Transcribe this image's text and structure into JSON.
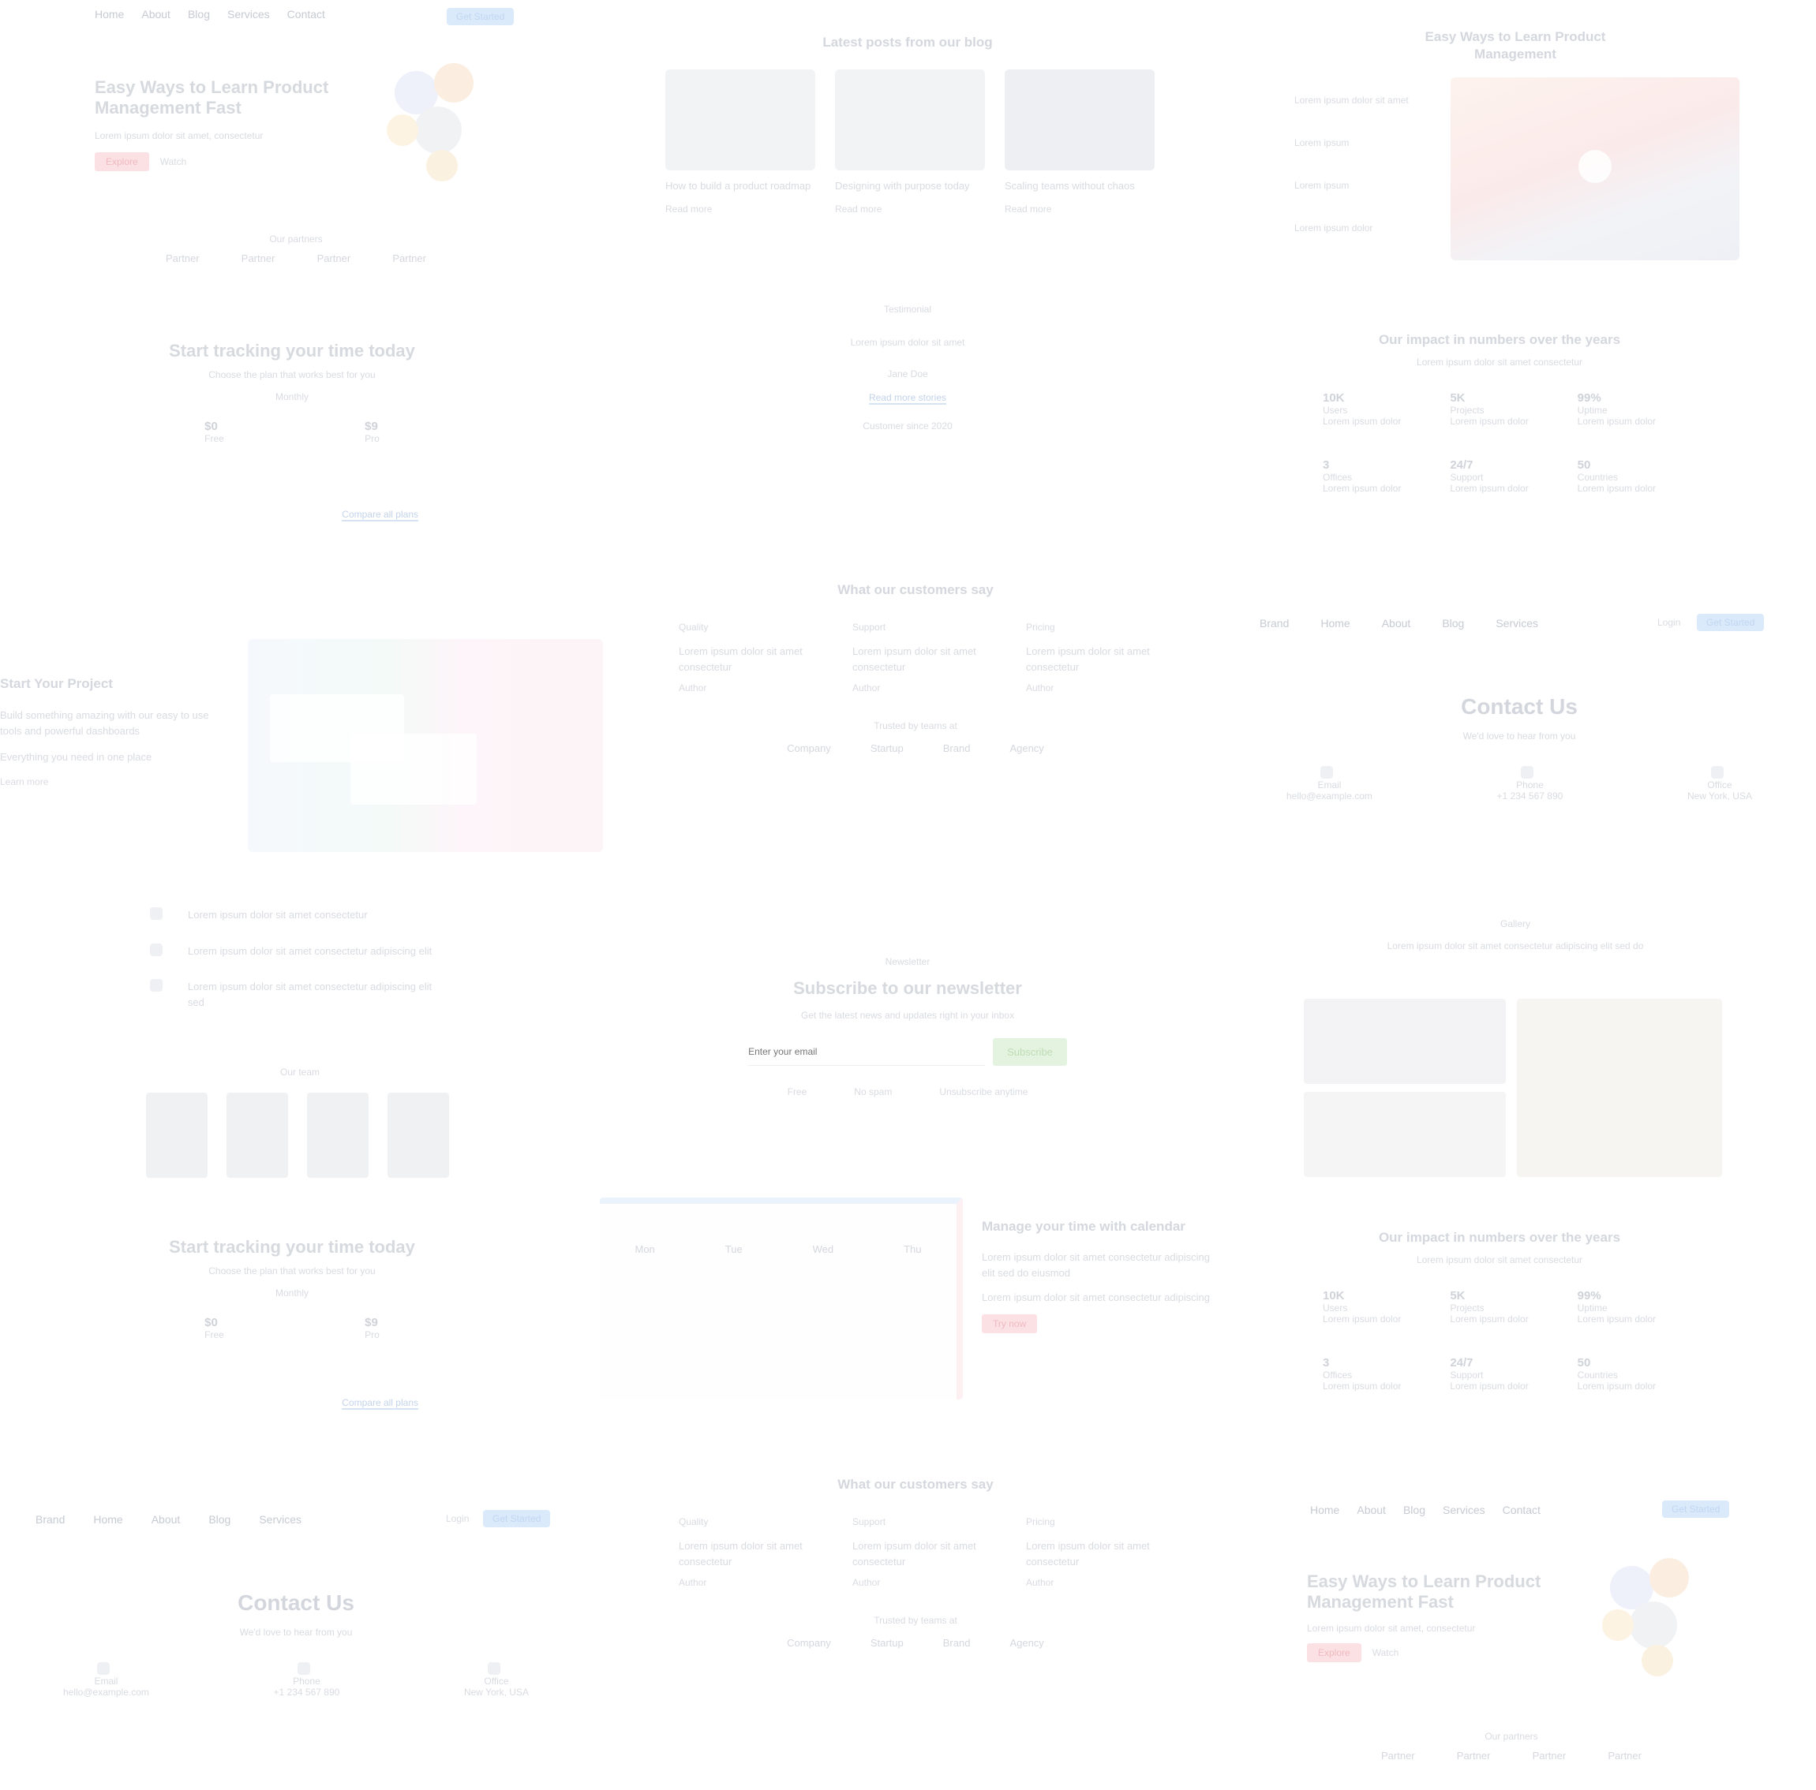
{
  "nav_a": {
    "items": [
      "Home",
      "About",
      "Blog",
      "Services",
      "Contact"
    ],
    "cta": "Get Started"
  },
  "hero_a": {
    "title": "Easy Ways to Learn Product Management Fast",
    "subtitle": "Lorem ipsum dolor sit amet, consectetur",
    "primary": "Explore",
    "secondary": "Watch",
    "partners_label": "Our partners",
    "partners": [
      "Partner",
      "Partner",
      "Partner",
      "Partner"
    ]
  },
  "pricing_a": {
    "title": "Start tracking your time today",
    "subtitle": "Choose the plan that works best for you",
    "toggle": "Monthly",
    "plans": [
      {
        "price": "$0",
        "name": "Free"
      },
      {
        "price": "$9",
        "name": "Pro"
      }
    ],
    "cta": "Compare all plans"
  },
  "project_a": {
    "title": "Start Your Project",
    "desc": "Build something amazing with our easy to use tools and powerful dashboards",
    "sub": "Everything you need in one place",
    "link": "Learn more"
  },
  "checklist": {
    "items": [
      "Lorem ipsum dolor sit amet consectetur",
      "Lorem ipsum dolor sit amet consectetur adipiscing elit",
      "Lorem ipsum dolor sit amet consectetur adipiscing elit sed"
    ],
    "team_label": "Our team"
  },
  "pricing_b": {
    "title": "Start tracking your time today",
    "subtitle": "Choose the plan that works best for you",
    "toggle": "Monthly",
    "plans": [
      {
        "price": "$0",
        "name": "Free"
      },
      {
        "price": "$9",
        "name": "Pro"
      }
    ],
    "cta": "Compare all plans"
  },
  "nav_b": {
    "logo": "Brand",
    "items": [
      "Home",
      "About",
      "Blog",
      "Services"
    ],
    "login": "Login",
    "cta": "Get Started"
  },
  "contact_a": {
    "title": "Contact Us",
    "subtitle": "We'd love to hear from you",
    "items": [
      {
        "label": "Email",
        "value": "hello@example.com"
      },
      {
        "label": "Phone",
        "value": "+1 234 567 890"
      },
      {
        "label": "Office",
        "value": "New York, USA"
      }
    ]
  },
  "articles": {
    "title": "Latest posts from our blog",
    "posts": [
      {
        "title": "How to build a product roadmap",
        "meta": "Read more"
      },
      {
        "title": "Designing with purpose today",
        "meta": "Read more"
      },
      {
        "title": "Scaling teams without chaos",
        "meta": "Read more"
      }
    ]
  },
  "testimonial": {
    "label": "Testimonial",
    "quote": "Lorem ipsum dolor sit amet",
    "author": "Jane Doe",
    "cta": "Read more stories",
    "note": "Customer since 2020"
  },
  "faq_a": {
    "title": "What our customers say",
    "cols": [
      {
        "h": "Quality",
        "t": "Lorem ipsum dolor sit amet consectetur",
        "m": "Author"
      },
      {
        "h": "Support",
        "t": "Lorem ipsum dolor sit amet consectetur",
        "m": "Author"
      },
      {
        "h": "Pricing",
        "t": "Lorem ipsum dolor sit amet consectetur",
        "m": "Author"
      }
    ],
    "logos_label": "Trusted by teams at",
    "logos": [
      "Company",
      "Startup",
      "Brand",
      "Agency"
    ]
  },
  "newsletter": {
    "eyebrow": "Newsletter",
    "title": "Subscribe to our newsletter",
    "subtitle": "Get the latest news and updates right in your inbox",
    "placeholder": "Enter your email",
    "cta": "Subscribe",
    "perks": [
      "Free",
      "No spam",
      "Unsubscribe anytime"
    ]
  },
  "calendar_feature": {
    "title": "Manage your time with calendar",
    "desc": "Lorem ipsum dolor sit amet consectetur adipiscing elit sed do eiusmod",
    "desc2": "Lorem ipsum dolor sit amet consectetur adipiscing",
    "cta": "Try now",
    "days": [
      "Mon",
      "Tue",
      "Wed",
      "Thu"
    ]
  },
  "faq_b": {
    "title": "What our customers say",
    "cols": [
      {
        "h": "Quality",
        "t": "Lorem ipsum dolor sit amet consectetur",
        "m": "Author"
      },
      {
        "h": "Support",
        "t": "Lorem ipsum dolor sit amet consectetur",
        "m": "Author"
      },
      {
        "h": "Pricing",
        "t": "Lorem ipsum dolor sit amet consectetur",
        "m": "Author"
      }
    ],
    "logos_label": "Trusted by teams at",
    "logos": [
      "Company",
      "Startup",
      "Brand",
      "Agency"
    ]
  },
  "nav_c": {
    "logo": "Brand",
    "items": [
      "Home",
      "About",
      "Blog",
      "Services"
    ],
    "login": "Login",
    "cta": "Get Started"
  },
  "contact_b": {
    "title": "Contact Us",
    "subtitle": "We'd love to hear from you",
    "items": [
      {
        "label": "Email",
        "value": "hello@example.com"
      },
      {
        "label": "Phone",
        "value": "+1 234 567 890"
      },
      {
        "label": "Office",
        "value": "New York, USA"
      }
    ]
  },
  "video": {
    "title": "Easy Ways to Learn Product Management",
    "items": [
      "Lorem ipsum dolor sit amet",
      "Lorem ipsum",
      "Lorem ipsum",
      "Lorem ipsum dolor"
    ]
  },
  "stats_a": {
    "title": "Our impact in numbers over the years",
    "subtitle": "Lorem ipsum dolor sit amet consectetur",
    "stats": [
      {
        "n": "10K",
        "l": "Users",
        "s": "Lorem ipsum dolor"
      },
      {
        "n": "5K",
        "l": "Projects",
        "s": "Lorem ipsum dolor"
      },
      {
        "n": "99%",
        "l": "Uptime",
        "s": "Lorem ipsum dolor"
      },
      {
        "n": "3",
        "l": "Offices",
        "s": "Lorem ipsum dolor"
      },
      {
        "n": "24/7",
        "l": "Support",
        "s": "Lorem ipsum dolor"
      },
      {
        "n": "50",
        "l": "Countries",
        "s": "Lorem ipsum dolor"
      }
    ]
  },
  "gallery": {
    "title": "Gallery",
    "subtitle": "Lorem ipsum dolor sit amet consectetur adipiscing elit sed do"
  },
  "stats_b": {
    "title": "Our impact in numbers over the years",
    "subtitle": "Lorem ipsum dolor sit amet consectetur",
    "stats": [
      {
        "n": "10K",
        "l": "Users",
        "s": "Lorem ipsum dolor"
      },
      {
        "n": "5K",
        "l": "Projects",
        "s": "Lorem ipsum dolor"
      },
      {
        "n": "99%",
        "l": "Uptime",
        "s": "Lorem ipsum dolor"
      },
      {
        "n": "3",
        "l": "Offices",
        "s": "Lorem ipsum dolor"
      },
      {
        "n": "24/7",
        "l": "Support",
        "s": "Lorem ipsum dolor"
      },
      {
        "n": "50",
        "l": "Countries",
        "s": "Lorem ipsum dolor"
      }
    ]
  },
  "nav_d": {
    "items": [
      "Home",
      "About",
      "Blog",
      "Services",
      "Contact"
    ],
    "cta": "Get Started"
  },
  "hero_b": {
    "title": "Easy Ways to Learn Product Management Fast",
    "subtitle": "Lorem ipsum dolor sit amet, consectetur",
    "primary": "Explore",
    "secondary": "Watch",
    "partners_label": "Our partners",
    "partners": [
      "Partner",
      "Partner",
      "Partner",
      "Partner"
    ]
  },
  "colors": {
    "blue": "#dbeafb",
    "red": "#fbe1e4",
    "green": "#e4f3df",
    "text": "#d3d6dc"
  }
}
